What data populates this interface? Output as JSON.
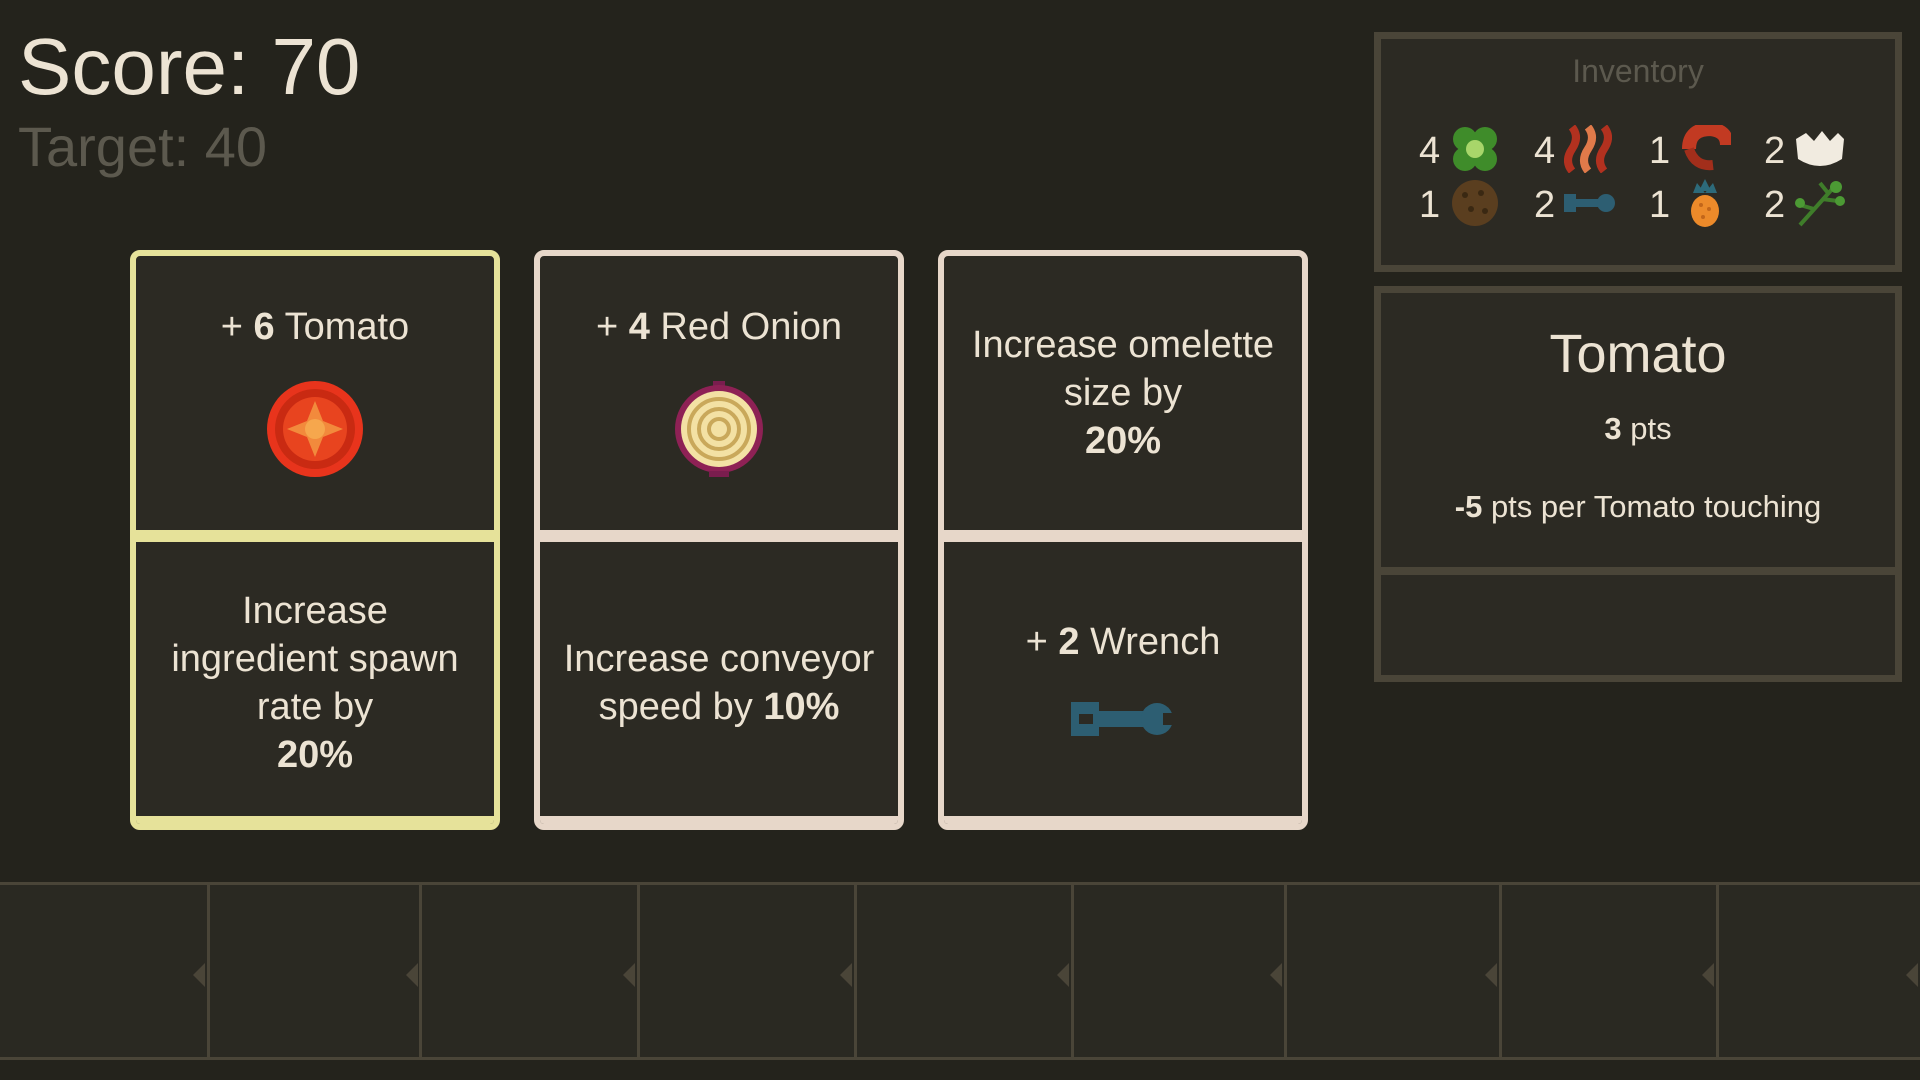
{
  "hud": {
    "score_label": "Score: 70",
    "target_label": "Target: 40"
  },
  "cards": [
    {
      "selected": true,
      "top": {
        "prefix": "+ ",
        "count": "6",
        "name": "Tomato",
        "icon": "tomato-icon"
      },
      "bottom": {
        "text": "Increase ingredient spawn rate by",
        "value": "20%"
      }
    },
    {
      "selected": false,
      "top": {
        "prefix": "+ ",
        "count": "4",
        "name": "Red Onion",
        "icon": "red-onion-icon"
      },
      "bottom": {
        "text": "Increase conveyor speed by",
        "value": "10%"
      }
    },
    {
      "selected": false,
      "top": {
        "text": "Increase omelette size by",
        "value": "20%"
      },
      "bottom": {
        "prefix": "+ ",
        "count": "2",
        "name": "Wrench",
        "icon": "wrench-icon"
      }
    }
  ],
  "inventory": {
    "title": "Inventory",
    "items": [
      {
        "count": "4",
        "icon": "green-pepper-icon"
      },
      {
        "count": "4",
        "icon": "bacon-icon"
      },
      {
        "count": "1",
        "icon": "shrimp-icon"
      },
      {
        "count": "2",
        "icon": "eggshell-icon"
      },
      {
        "count": "1",
        "icon": "mushroom-icon"
      },
      {
        "count": "2",
        "icon": "wrench-icon"
      },
      {
        "count": "1",
        "icon": "pineapple-icon"
      },
      {
        "count": "2",
        "icon": "parsley-icon"
      }
    ]
  },
  "detail": {
    "title": "Tomato",
    "pts_value": "3",
    "pts_label": " pts",
    "rule_value": "-5",
    "rule_text": " pts per Tomato touching"
  },
  "colors": {
    "background": "#24231c",
    "panel": "#2c2a23",
    "card_border": "#e7d7c9",
    "card_selected_border": "#e6e29a",
    "text": "#ece3d3",
    "muted_text": "#5c594e"
  }
}
